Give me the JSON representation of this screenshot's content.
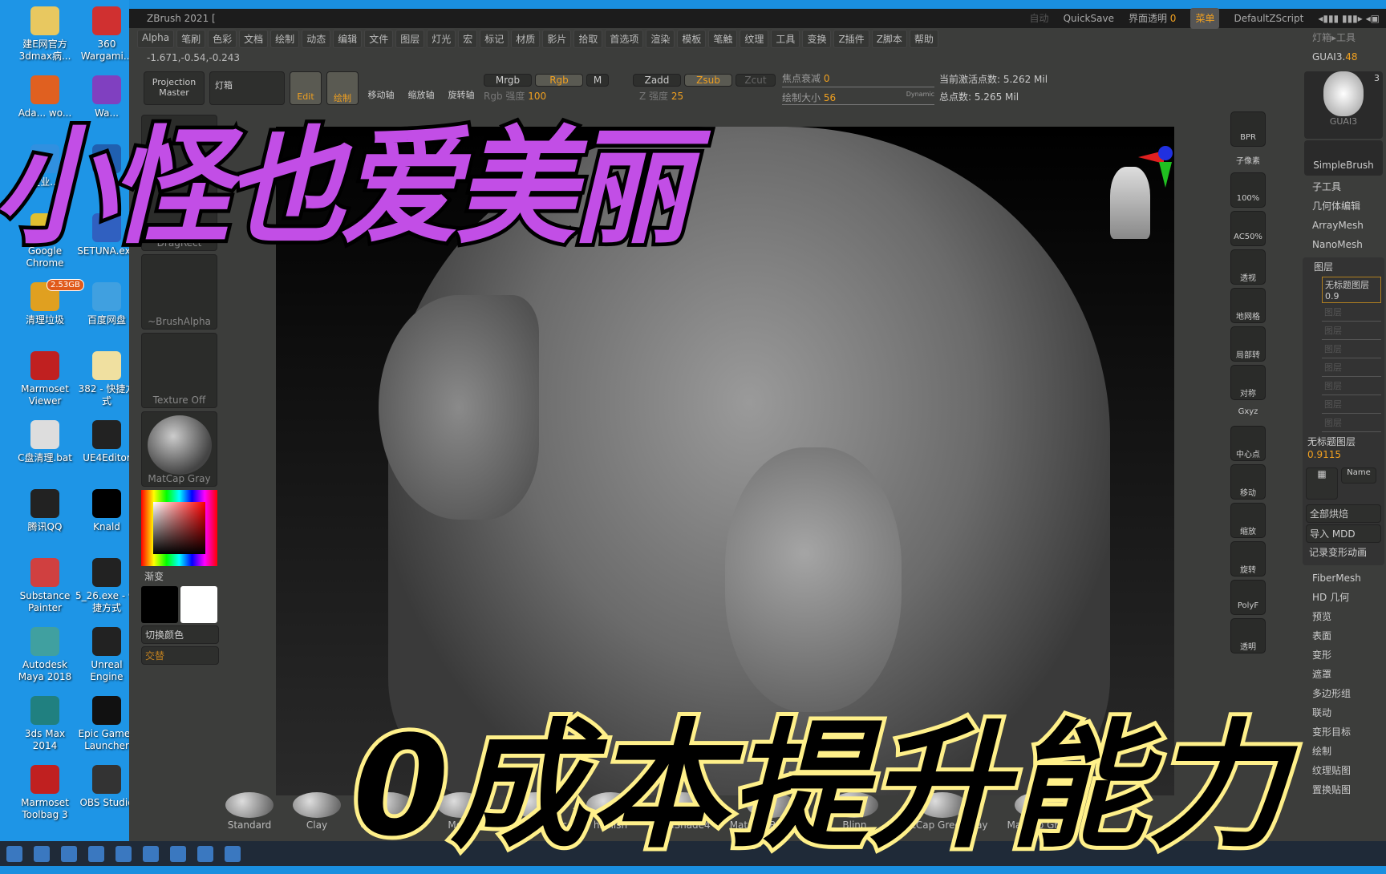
{
  "desktop": {
    "icons": [
      {
        "label": "建E网官方 3dmax病...",
        "color": "#e8c860"
      },
      {
        "label": "360 Wargami...",
        "color": "#d03030"
      },
      {
        "label": "Ada... wo...",
        "color": "#e06020"
      },
      {
        "label": "Wa...",
        "color": "#8040c0"
      },
      {
        "label": "企业...",
        "color": "#3090e0"
      },
      {
        "label": "",
        "color": "#2060b0"
      },
      {
        "label": "Google Chrome",
        "color": "#e0c030"
      },
      {
        "label": "SETUNA.exe",
        "color": "#3060c0"
      },
      {
        "label": "清理垃圾",
        "color": "#e0a020",
        "badge": "2.53GB"
      },
      {
        "label": "百度网盘",
        "color": "#40a0e0"
      },
      {
        "label": "Marmoset Viewer",
        "color": "#c02020"
      },
      {
        "label": "382 - 快捷方式",
        "color": "#f0e0a0"
      },
      {
        "label": "C盘清理.bat",
        "color": "#ddd"
      },
      {
        "label": "UE4Editor",
        "color": "#222"
      },
      {
        "label": "腾讯QQ",
        "color": "#222"
      },
      {
        "label": "Knald",
        "color": "#000"
      },
      {
        "label": "Substance Painter",
        "color": "#d04040"
      },
      {
        "label": "5_26.exe - 快捷方式",
        "color": "#222"
      },
      {
        "label": "Autodesk Maya 2018",
        "color": "#40a0a0"
      },
      {
        "label": "Unreal Engine",
        "color": "#222"
      },
      {
        "label": "3ds Max 2014",
        "color": "#208080"
      },
      {
        "label": "Epic Games Launcher",
        "color": "#111"
      },
      {
        "label": "Marmoset Toolbag 3",
        "color": "#c02020"
      },
      {
        "label": "OBS Studio",
        "color": "#333"
      }
    ]
  },
  "window": {
    "title": "ZBrush 2021 [",
    "auto": "自动",
    "quicksave": "QuickSave",
    "ui_transparency_label": "界面透明",
    "ui_transparency_value": "0",
    "menu_btn": "菜单",
    "script": "DefaultZScript"
  },
  "menu": [
    "Alpha",
    "笔刷",
    "色彩",
    "文档",
    "绘制",
    "动态",
    "编辑",
    "文件",
    "图层",
    "灯光",
    "宏",
    "标记",
    "材质",
    "影片",
    "拾取",
    "首选项",
    "渲染",
    "模板",
    "笔触",
    "纹理",
    "工具",
    "变换",
    "Z插件",
    "Z脚本",
    "帮助"
  ],
  "coords": "-1.671,-0.54,-0.243",
  "shelf": {
    "projection_master": "Projection Master",
    "lightbox": "灯箱",
    "edit": "Edit",
    "draw": "绘制",
    "move": "移动轴",
    "scale": "缩放轴",
    "rotate": "旋转轴",
    "mrgb": "Mrgb",
    "rgb": "Rgb",
    "m": "M",
    "rgb_intensity_label": "Rgb 强度",
    "rgb_intensity": "100",
    "zadd": "Zadd",
    "zsub": "Zsub",
    "zcut": "Zcut",
    "z_intensity_label": "Z 强度",
    "z_intensity": "25",
    "focal_label": "焦点衰减",
    "focal": "0",
    "draw_size_label": "绘制大小",
    "draw_size": "56",
    "dynamic": "Dynamic",
    "active_points": "当前激活点数: 5.262 Mil",
    "total_points": "总点数: 5.265 Mil"
  },
  "tray": {
    "stroke": "DragRect",
    "alpha": "~BrushAlpha",
    "texture": "Texture Off",
    "material": "MatCap Gray",
    "gradient": "渐变",
    "switch_color": "切换颜色",
    "alternate": "交替"
  },
  "right_shelf": [
    "BPR",
    "子像素",
    "100%",
    "AC50%",
    "透视",
    "地网格",
    "局部转",
    "对称",
    "Gxyz",
    "中心点",
    "移动",
    "缩放",
    "旋转",
    "PolyF",
    "透明"
  ],
  "right_panel": {
    "header": "灯箱▸工具",
    "tool_name": "GUAI3.",
    "tool_value": "48",
    "thumb_label": "GUAI3",
    "thumb_count": "3",
    "brush": "SimpleBrush",
    "items": [
      "子工具",
      "几何体编辑",
      "ArrayMesh",
      "NanoMesh"
    ],
    "layers_title": "图层",
    "layer_active": "无标题图层 0.9",
    "layer_slots": [
      "图层",
      "图层",
      "图层",
      "图层",
      "图层",
      "图层",
      "图层"
    ],
    "layer_footer": "无标题图层",
    "layer_footer_value": "0.9115",
    "name_btn": "Name",
    "bake_all": "全部烘焙",
    "import_mdd": "导入 MDD",
    "record": "记录变形动画",
    "items2": [
      "FiberMesh",
      "HD 几何",
      "预览",
      "表面",
      "变形",
      "遮罩",
      "多边形组",
      "联动",
      "变形目标",
      "绘制",
      "纹理贴图",
      "置换贴图"
    ]
  },
  "brushes": [
    "Standard",
    "Clay",
    "ClayBuildup",
    "Move",
    "TrimDynamic",
    "hPolish",
    "SkinShade4",
    "MatCap Red Wax",
    "Blinn",
    "MatCap GreenClay",
    "MatCap Gray"
  ],
  "overlay": {
    "title_top": "小怪也爱美丽",
    "title_bottom": "0成本提升能力",
    "top_color": "#c24ee6",
    "bottom_stroke": "#fff08a"
  },
  "colors": {
    "accent": "#f0a020",
    "panel": "#3c3d3b"
  }
}
